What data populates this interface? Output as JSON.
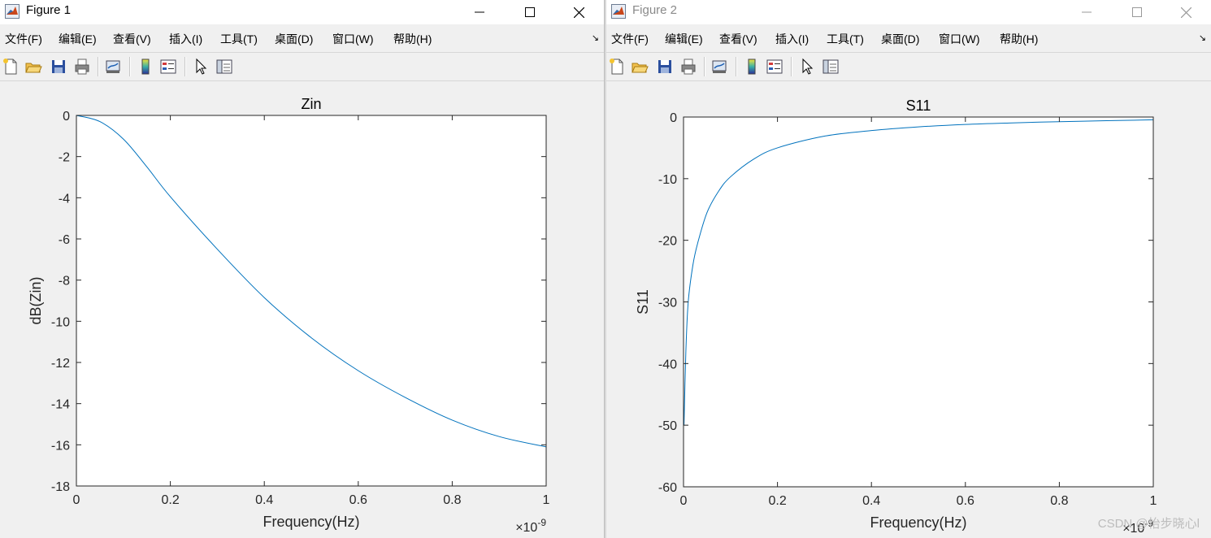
{
  "menu": [
    "文件(F)",
    "编辑(E)",
    "查看(V)",
    "插入(I)",
    "工具(T)",
    "桌面(D)",
    "窗口(W)",
    "帮助(H)"
  ],
  "figures": [
    {
      "title": "Figure 1",
      "active": true,
      "chart_data": {
        "type": "line",
        "title": "Zin",
        "xlabel": "Frequency(Hz)",
        "ylabel": "dB(Zin)",
        "xlim": [
          0,
          1e-09
        ],
        "ylim": [
          -18,
          0
        ],
        "x_tick_labels": [
          "0",
          "0.2",
          "0.4",
          "0.6",
          "0.8",
          "1"
        ],
        "y_tick_labels": [
          "0",
          "-2",
          "-4",
          "-6",
          "-8",
          "-10",
          "-12",
          "-14",
          "-16",
          "-18"
        ],
        "x_exponent_label": "×10",
        "x_exponent": "-9",
        "grid": false,
        "color": "#0072bd",
        "series": [
          {
            "x": [
              0,
              5e-11,
              1e-10,
              1.5e-10,
              2e-10,
              3e-10,
              4e-10,
              5e-10,
              6e-10,
              7e-10,
              8e-10,
              9e-10,
              1e-09
            ],
            "y": [
              0,
              -0.3,
              -1.15,
              -2.5,
              -3.95,
              -6.5,
              -8.85,
              -10.8,
              -12.4,
              -13.7,
              -14.8,
              -15.6,
              -16.1
            ]
          }
        ]
      }
    },
    {
      "title": "Figure 2",
      "active": false,
      "chart_data": {
        "type": "line",
        "title": "S11",
        "xlabel": "Frequency(Hz)",
        "ylabel": "S11",
        "xlim": [
          0,
          1e-09
        ],
        "ylim": [
          -60,
          0
        ],
        "x_tick_labels": [
          "0",
          "0.2",
          "0.4",
          "0.6",
          "0.8",
          "1"
        ],
        "y_tick_labels": [
          "0",
          "-10",
          "-20",
          "-30",
          "-40",
          "-50",
          "-60"
        ],
        "x_exponent_label": "×10",
        "x_exponent": "-9",
        "grid": false,
        "color": "#0072bd",
        "series": [
          {
            "x": [
              1e-12,
              5e-12,
              1e-11,
              2e-11,
              3e-11,
              5e-11,
              7.5e-11,
              1e-10,
              1.5e-10,
              2e-10,
              3e-10,
              4e-10,
              5e-10,
              6e-10,
              7e-10,
              8e-10,
              9e-10,
              1e-09
            ],
            "y": [
              -50,
              -38,
              -30,
              -24,
              -20.5,
              -15.5,
              -12,
              -9.7,
              -6.8,
              -5.0,
              -3.1,
              -2.2,
              -1.6,
              -1.2,
              -0.95,
              -0.75,
              -0.6,
              -0.45
            ]
          }
        ]
      }
    }
  ],
  "watermark": "CSDN @怡步晓心l"
}
